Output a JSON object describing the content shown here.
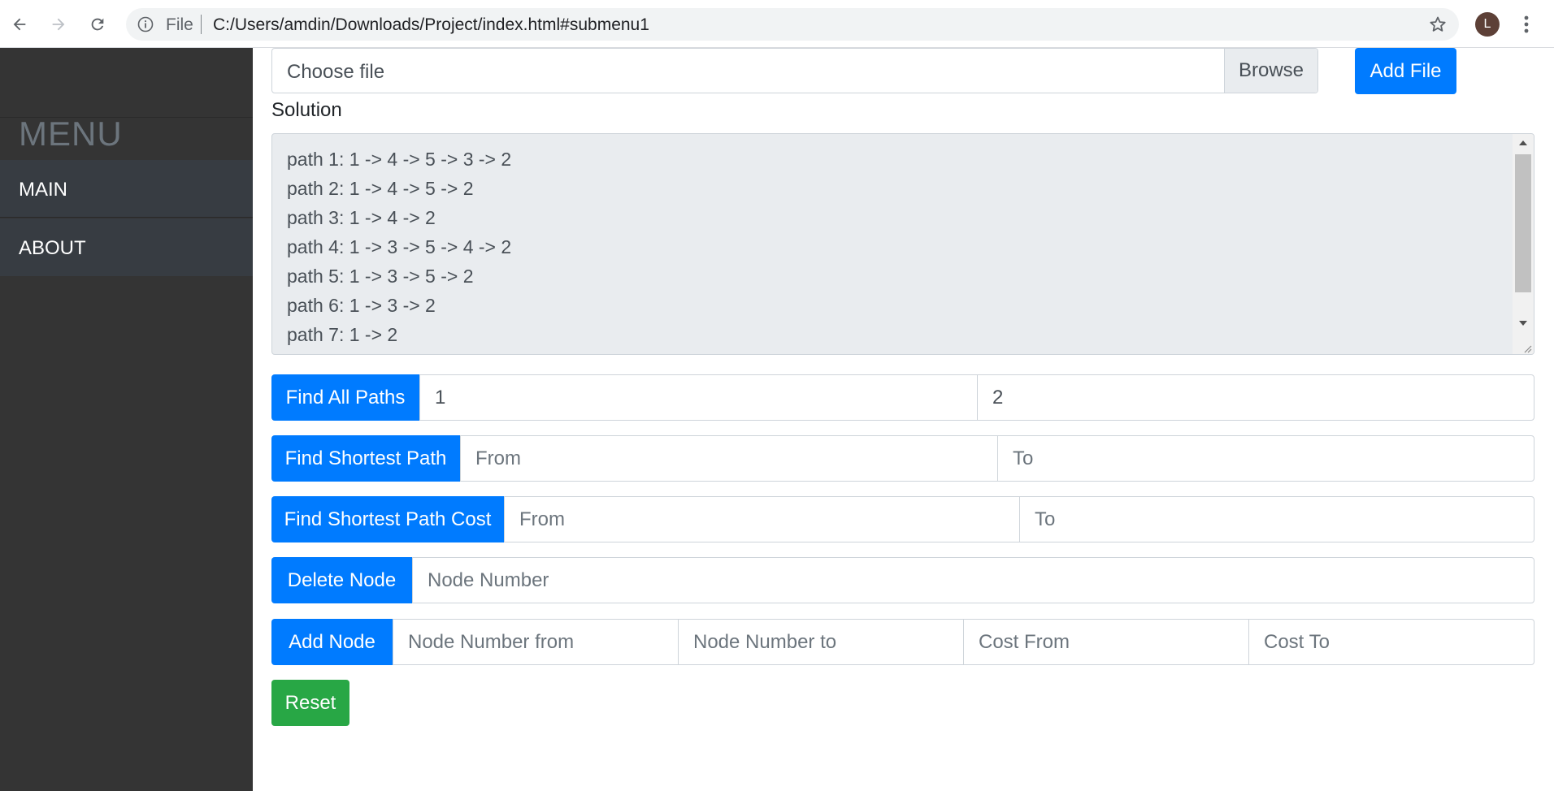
{
  "browser": {
    "file_label": "File",
    "url": "C:/Users/amdin/Downloads/Project/index.html#submenu1",
    "avatar_letter": "L"
  },
  "sidebar": {
    "title": "MENU",
    "items": [
      {
        "label": "MAIN"
      },
      {
        "label": "ABOUT"
      }
    ]
  },
  "upload": {
    "choose_label": "Choose file",
    "browse_label": "Browse",
    "add_file_label": "Add File"
  },
  "solution": {
    "label": "Solution",
    "lines": [
      "path 1: 1 -> 4 -> 5 -> 3 -> 2",
      "path 2: 1 -> 4 -> 5 -> 2",
      "path 3: 1 -> 4 -> 2",
      "path 4: 1 -> 3 -> 5 -> 4 -> 2",
      "path 5: 1 -> 3 -> 5 -> 2",
      "path 6: 1 -> 3 -> 2",
      "path 7: 1 -> 2"
    ]
  },
  "find_all_paths": {
    "button": "Find All Paths",
    "from_value": "1",
    "to_value": "2"
  },
  "find_shortest_path": {
    "button": "Find Shortest Path",
    "from_placeholder": "From",
    "to_placeholder": "To"
  },
  "find_shortest_path_cost": {
    "button": "Find Shortest Path Cost",
    "from_placeholder": "From",
    "to_placeholder": "To"
  },
  "delete_node": {
    "button": "Delete Node",
    "placeholder": "Node Number"
  },
  "add_node": {
    "button": "Add Node",
    "from_placeholder": "Node Number from",
    "to_placeholder": "Node Number to",
    "cost_from_placeholder": "Cost From",
    "cost_to_placeholder": "Cost To"
  },
  "reset": {
    "button": "Reset"
  },
  "colors": {
    "primary": "#007bff",
    "success": "#28a745",
    "sidebar_bg": "#343434",
    "sidebar_item_bg": "#373c42"
  }
}
